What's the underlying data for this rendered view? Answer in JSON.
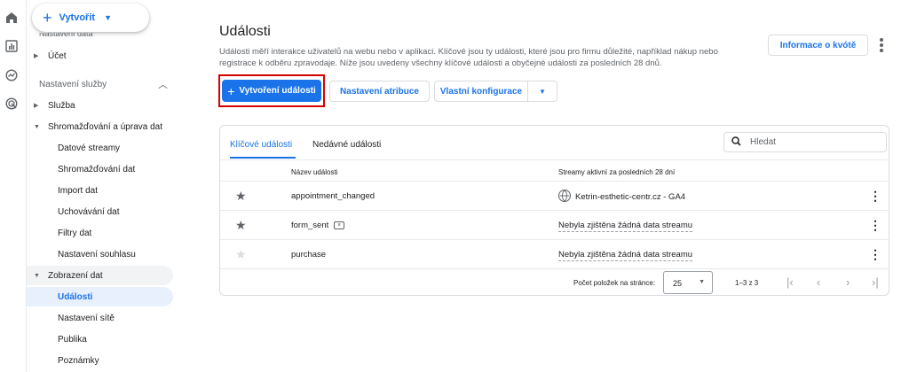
{
  "rail": {
    "icons": [
      "home-icon",
      "bar-chart-icon",
      "explore-icon",
      "target-icon"
    ]
  },
  "sidebar": {
    "create_label": "Vytvořit",
    "cut_text": "Nastavení data",
    "account": "Účet",
    "section": "Nastavení služby",
    "service": "Služba",
    "collection": "Shromažďování a úprava dat",
    "collection_items": [
      "Datové streamy",
      "Shromažďování dat",
      "Import dat",
      "Uchovávání dat",
      "Filtry dat",
      "Nastavení souhlasu"
    ],
    "display": "Zobrazení dat",
    "display_items": [
      "Události",
      "Nastavení sítě",
      "Publika",
      "Poznámky"
    ]
  },
  "header": {
    "title": "Události",
    "description": "Události měří interakce uživatelů na webu nebo v aplikaci. Klíčové jsou ty události, které jsou pro firmu důležité, například nákup nebo registrace k odběru zpravodaje. Níže jsou uvedeny všechny klíčové události a obyčejné události za posledních 28 dnů.",
    "info_button": "Informace o kvótě"
  },
  "toolbar": {
    "create_event": "Vytvoření události",
    "attribution": "Nastavení atribuce",
    "custom_config": "Vlastní konfigurace"
  },
  "table": {
    "tabs": [
      "Klíčové události",
      "Nedávné události"
    ],
    "search_placeholder": "Hledat",
    "headers": [
      "Název události",
      "Streamy aktivní za posledních 28 dní"
    ],
    "rows": [
      {
        "name": "appointment_changed",
        "stream": "Ketrin-esthetic-centr.cz - GA4",
        "starred": true
      },
      {
        "name": "form_sent",
        "stream": "Nebyla zjištěna žádná data streamu",
        "starred": true
      },
      {
        "name": "purchase",
        "stream": "Nebyla zjištěna žádná data streamu",
        "starred": false
      }
    ],
    "pagination": {
      "label": "Počet položek na stránce:",
      "per_page": "25",
      "range": "1–3 z 3"
    }
  },
  "colors": {
    "accent": "#1a73e8",
    "highlight": "#d50000"
  }
}
